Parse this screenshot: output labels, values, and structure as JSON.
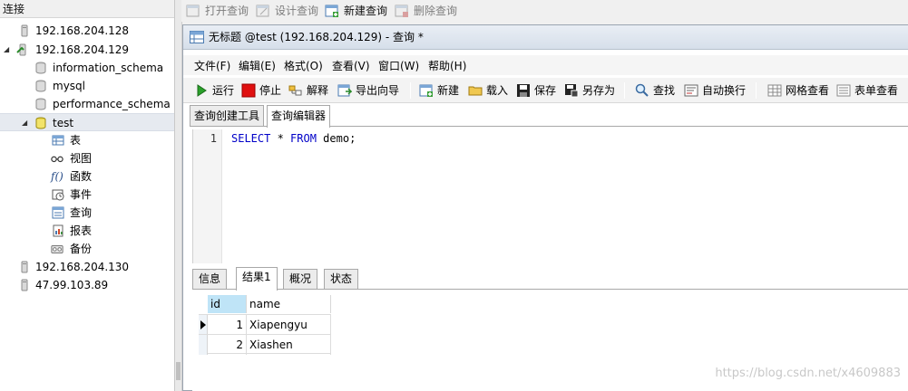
{
  "left_panel": {
    "header": "连接",
    "tree": [
      {
        "label": "192.168.204.128",
        "level": 0,
        "type": "connection",
        "expanded": false
      },
      {
        "label": "192.168.204.129",
        "level": 0,
        "type": "connection-open",
        "expanded": true
      },
      {
        "label": "information_schema",
        "level": 1,
        "type": "database"
      },
      {
        "label": "mysql",
        "level": 1,
        "type": "database"
      },
      {
        "label": "performance_schema",
        "level": 1,
        "type": "database"
      },
      {
        "label": "test",
        "level": 1,
        "type": "database-open",
        "expanded": true,
        "selected": true
      },
      {
        "label": "表",
        "level": 2,
        "type": "tables"
      },
      {
        "label": "视图",
        "level": 2,
        "type": "views"
      },
      {
        "label": "函数",
        "level": 2,
        "type": "functions"
      },
      {
        "label": "事件",
        "level": 2,
        "type": "events"
      },
      {
        "label": "查询",
        "level": 2,
        "type": "queries"
      },
      {
        "label": "报表",
        "level": 2,
        "type": "reports"
      },
      {
        "label": "备份",
        "level": 2,
        "type": "backups"
      },
      {
        "label": "192.168.204.130",
        "level": 0,
        "type": "connection"
      },
      {
        "label": "47.99.103.89",
        "level": 0,
        "type": "connection"
      }
    ]
  },
  "topbar": {
    "open_query": "打开查询",
    "design_query": "设计查询",
    "new_query": "新建查询",
    "delete_query": "删除查询"
  },
  "window": {
    "title": "无标题 @test (192.168.204.129) - 查询 *",
    "menu": [
      "文件(F)",
      "编辑(E)",
      "格式(O)",
      "查看(V)",
      "窗口(W)",
      "帮助(H)"
    ],
    "toolbar": {
      "run": "运行",
      "stop": "停止",
      "explain": "解释",
      "export_wizard": "导出向导",
      "new": "新建",
      "load": "载入",
      "save": "保存",
      "save_as": "另存为",
      "find": "查找",
      "wrap": "自动换行",
      "grid_view": "网格查看",
      "form_view": "表单查看"
    },
    "tabs": [
      "查询创建工具",
      "查询编辑器"
    ],
    "active_tab": "查询编辑器",
    "editor": {
      "line_number": "1",
      "kw_select": "SELECT",
      "star": " * ",
      "kw_from": "FROM",
      "rest": " demo;"
    },
    "result_tabs": [
      "信息",
      "结果1",
      "概况",
      "状态"
    ],
    "active_result_tab": "结果1",
    "result": {
      "columns": [
        "id",
        "name"
      ],
      "rows": [
        [
          "1",
          "Xiapengyu"
        ],
        [
          "2",
          "Xiashen"
        ]
      ]
    }
  },
  "watermark": "https://blog.csdn.net/x4609883"
}
